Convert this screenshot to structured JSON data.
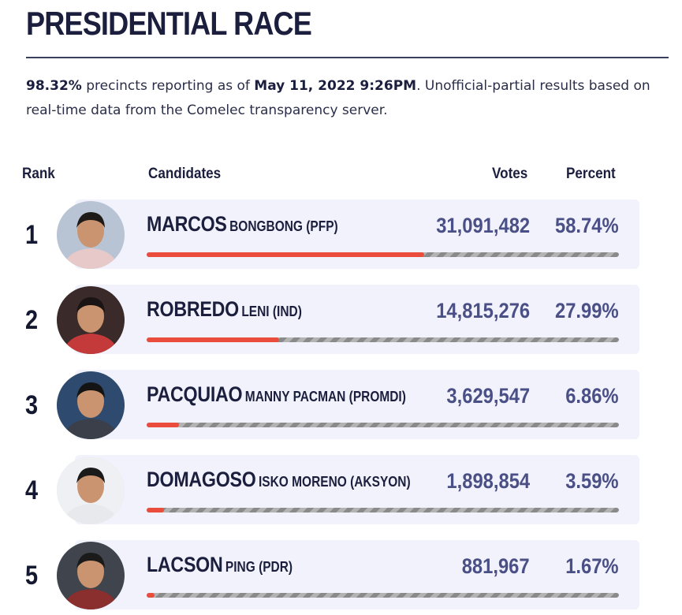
{
  "header": {
    "title": "PRESIDENTIAL RACE"
  },
  "summary": {
    "precincts_pct": "98.32%",
    "text1": " precincts reporting as of ",
    "as_of": "May 11, 2022 9:26PM",
    "text2": ". Unofficial-partial results based on real-time data from the Comelec transparency server."
  },
  "table": {
    "headers": {
      "rank": "Rank",
      "candidates": "Candidates",
      "votes": "Votes",
      "percent": "Percent"
    },
    "rows": [
      {
        "rank": "1",
        "surname": "MARCOS",
        "given": "BONGBONG (PFP)",
        "votes": "31,091,482",
        "percent": "58.74%",
        "share": 58.74,
        "avatar_icon": "portrait-photo"
      },
      {
        "rank": "2",
        "surname": "ROBREDO",
        "given": "LENI (IND)",
        "votes": "14,815,276",
        "percent": "27.99%",
        "share": 27.99,
        "avatar_icon": "portrait-photo"
      },
      {
        "rank": "3",
        "surname": "PACQUIAO",
        "given": "MANNY PACMAN (PROMDI)",
        "votes": "3,629,547",
        "percent": "6.86%",
        "share": 6.86,
        "avatar_icon": "portrait-photo"
      },
      {
        "rank": "4",
        "surname": "DOMAGOSO",
        "given": "ISKO MORENO (AKSYON)",
        "votes": "1,898,854",
        "percent": "3.59%",
        "share": 3.59,
        "avatar_icon": "portrait-photo"
      },
      {
        "rank": "5",
        "surname": "LACSON",
        "given": "PING (PDR)",
        "votes": "881,967",
        "percent": "1.67%",
        "share": 1.67,
        "avatar_icon": "portrait-photo"
      }
    ]
  },
  "colors": {
    "title": "#1b1f3d",
    "value_text": "#4a4f86",
    "bar_fill": "#ea4d3b",
    "card_bg": "#f1f2fb"
  }
}
